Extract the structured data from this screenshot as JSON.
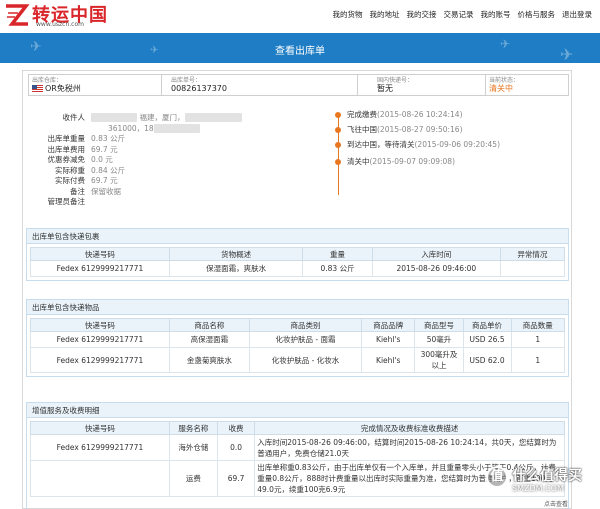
{
  "brand": {
    "name": "转运中国",
    "url": "www.uszcn.com",
    "accent_color": "#d9262b",
    "banner_color": "#1e7dc4",
    "highlight_color": "#e87722"
  },
  "nav": [
    "我的货物",
    "我的地址",
    "我的交接",
    "交易记录",
    "我的账号",
    "价格与服务",
    "退出登录"
  ],
  "page_title": "查看出库单",
  "info": {
    "warehouse_label": "出库仓库：",
    "warehouse_value": "OR免税州",
    "order_label": "出库单号：",
    "order_value": "00826137370",
    "domestic_label": "国内快递号：",
    "domestic_value": "暂无",
    "status_label": "当前状态：",
    "status_value": "清关中"
  },
  "details": [
    {
      "label": "收件人",
      "value": "福建，厦门，"
    },
    {
      "label": "",
      "value": "361000，18"
    },
    {
      "label": "出库单重量",
      "value": "0.83 公斤"
    },
    {
      "label": "出库单费用",
      "value": "69.7 元"
    },
    {
      "label": "优惠券减免",
      "value": "0.0 元"
    },
    {
      "label": "实际称重",
      "value": "0.84 公斤"
    },
    {
      "label": "实际付费",
      "value": "69.7 元"
    },
    {
      "label": "备注",
      "value": "保留收据"
    },
    {
      "label": "管理员备注",
      "value": ""
    }
  ],
  "timeline": [
    {
      "event": "完成缴费",
      "time": "(2015-08-26 10:24:14)"
    },
    {
      "event": "飞往中国",
      "time": "(2015-08-27 09:50:16)"
    },
    {
      "event": "到达中国，等待清关",
      "time": "(2015-09-06 09:20:45)"
    },
    {
      "event": "清关中",
      "time": "(2015-09-07 09:09:08)"
    }
  ],
  "packages": {
    "title": "出库单包含快递包裹",
    "headers": [
      "快递号码",
      "货物概述",
      "重量",
      "入库时间",
      "异常情况"
    ],
    "rows": [
      [
        "Fedex 6129999217771",
        "保湿面霜，爽肤水",
        "0.83 公斤",
        "2015-08-26 09:46:00",
        ""
      ]
    ]
  },
  "goods": {
    "title": "出库单包含快递物品",
    "headers": [
      "快递号码",
      "商品名称",
      "商品类别",
      "商品品牌",
      "商品型号",
      "商品单价",
      "商品数量"
    ],
    "rows": [
      [
        "Fedex 6129999217771",
        "高保湿面霜",
        "化妆护肤品 - 面霜",
        "Kiehl's",
        "50毫升",
        "USD 26.5",
        "1"
      ],
      [
        "Fedex 6129999217771",
        "金盏菊爽肤水",
        "化妆护肤品 - 化妆水",
        "Kiehl's",
        "300毫升及以上",
        "USD 62.0",
        "1"
      ]
    ]
  },
  "services": {
    "title": "增值服务及收费明细",
    "headers": [
      "快递号码",
      "服务名称",
      "收费",
      "完成情况及收费标准收费描述"
    ],
    "rows": [
      [
        "Fedex 6129999217771",
        "海外仓储",
        "0.0",
        "入库时间2015-08-26 09:46:00，结算时间2015-08-26 10:24:14，共0天，您结算时为普通用户，免费仓储21.0天"
      ],
      [
        "",
        "运费",
        "69.7",
        "出库单称重0.83公斤，由于出库单仅有一个入库单，并且重量零头小于等于0.4公斤，计费重量0.8公斤，888时计费重量以出库时实际重量为准，您结算时为普通用户，首重100克49.0元，续重100克6.9元"
      ]
    ]
  },
  "watermark": {
    "badge": "值",
    "text": "什么值得买",
    "sub": "SMZDM.COM",
    "foot": "点击查看"
  }
}
